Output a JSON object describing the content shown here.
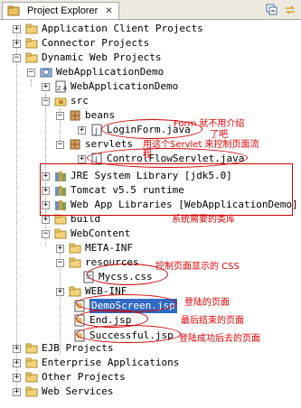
{
  "view": {
    "title": "Project Explorer",
    "close_label": "✕"
  },
  "tree": {
    "application_client_projects": "Application Client Projects",
    "connector_projects": "Connector Projects",
    "dynamic_web_projects": "Dynamic Web Projects",
    "webapplicationdemo": "WebApplicationDemo",
    "deployment_descriptor": "WebApplicationDemo",
    "src": "src",
    "beans": "beans",
    "loginform": "LoginForm.java",
    "servlets": "servlets",
    "controlflowservlet": "ControlFlowServlet.java",
    "jre": "JRE System Library [jdk5.0]",
    "tomcat": "Tomcat v5.5 runtime",
    "webapplibs": "Web App Libraries [WebApplicationDemo]",
    "build": "build",
    "webcontent": "WebContent",
    "metainf": "META-INF",
    "resources": "resources",
    "mycss": "Mycss.css",
    "webinf": "WEB-INF",
    "demoscreen": "DemoScreen.jsp",
    "endjsp": "End.jsp",
    "successful": "Successful.jsp",
    "ejb_projects": "EJB Projects",
    "enterprise_apps": "Enterprise Applications",
    "other_projects": "Other Projects",
    "web_services": "Web Services"
  },
  "annotations": {
    "form": "Form  就不用介绍",
    "form2": "了吧",
    "servlet": "用这个Servlet 来控制页面流",
    "servlet2": "程",
    "libs": "系统需要的类库",
    "css": "控制页面显示的 CSS",
    "login_page": "登陆的页面",
    "end_page": "最后结束的页面",
    "success_page": "登陆成功后去的页面"
  },
  "colors": {
    "annotation": "#e00000",
    "selection": "#316ac5"
  }
}
